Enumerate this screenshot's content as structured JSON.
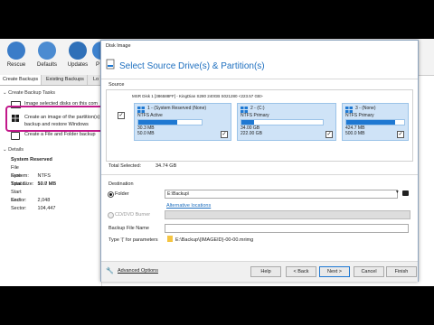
{
  "toolbar": {
    "buttons": [
      {
        "label": "Rescue",
        "icon": "rescue-icon"
      },
      {
        "label": "Defaults",
        "icon": "defaults-icon"
      },
      {
        "label": "Updates",
        "icon": "updates-icon"
      },
      {
        "label": "P",
        "icon": "p-icon"
      }
    ]
  },
  "tabs": [
    "Create Backups",
    "Existing Backups",
    "Lo"
  ],
  "left": {
    "tasks_header": "Create Backup Tasks",
    "tasks": [
      "Image selected disks on this com",
      "Create an image of the partition(s)",
      "backup and restore Windows",
      "Create a File and Folder backup"
    ],
    "details_header": "Details",
    "details_title": "System Reserved",
    "details": [
      {
        "k": "File System:",
        "v": "NTFS"
      },
      {
        "k": "Free Space:",
        "v": "19.7 MB"
      },
      {
        "k": "Total Size:",
        "v": "50.0 MB"
      },
      {
        "k": "Start Sector:",
        "v": "2,048"
      },
      {
        "k": "End Sector:",
        "v": "104,447"
      }
    ]
  },
  "dialog": {
    "window_title": "Disk Image",
    "heading": "Select Source Drive(s) & Partition(s)",
    "source_label": "Source",
    "disk_title": "MSR Disk 1 [386588FF] - KingDian S280 240GB S021280  <223.57 GB>",
    "partitions": [
      {
        "name": "1 - (System Reserved (None)",
        "type": "NTFS Active",
        "used": "30.3 MB",
        "size": "50.0 MB",
        "fill": 0.61,
        "checked": true
      },
      {
        "name": "2 - (C:)",
        "type": "NTFS Primary",
        "used": "34.00 GB",
        "size": "222.00 GB",
        "fill": 0.15,
        "checked": true
      },
      {
        "name": "3 - (None)",
        "type": "NTFS Primary",
        "used": "424.7 MB",
        "size": "500.0 MB",
        "fill": 0.85,
        "checked": true
      }
    ],
    "total_selected_label": "Total Selected:",
    "total_selected_value": "34.74 GB",
    "destination_label": "Destination",
    "folder_label": "Folder",
    "folder_value": "E:\\Backup\\",
    "alt_locations": "Alternative locations",
    "cd_label": "CD/DVD Burner",
    "backup_file_label": "Backup File Name",
    "type_label": "Type '(' for parameters",
    "file_pattern": "E:\\Backup\\{IMAGEID}-00-00.mrimg",
    "advanced": "Advanced Options",
    "buttons": {
      "help": "Help",
      "back": "< Back",
      "next": "Next >",
      "cancel": "Cancel",
      "finish": "Finish"
    }
  },
  "colors": {
    "accent": "#1e6fbf",
    "highlight": "#c2188a",
    "partition": "#cfe3f7",
    "bar": "#1e78d2"
  }
}
